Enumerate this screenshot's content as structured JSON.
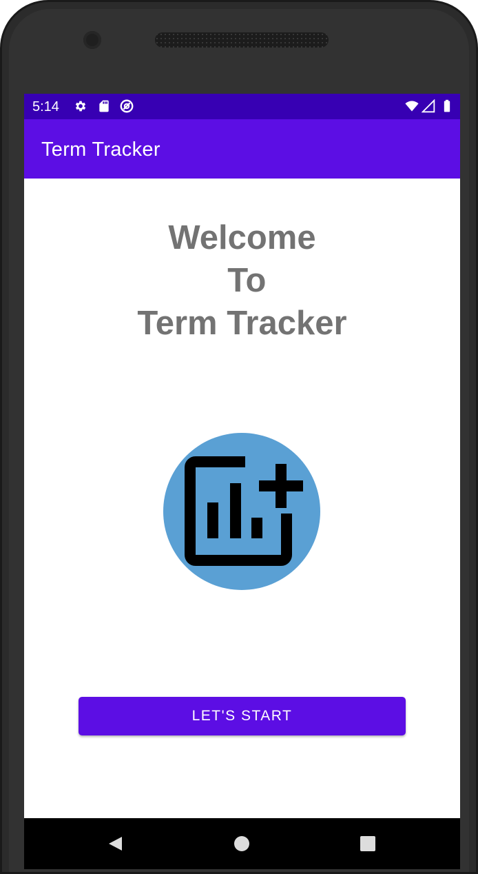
{
  "status_bar": {
    "time": "5:14",
    "icons": [
      "settings-icon",
      "sd-card-icon",
      "sync-icon",
      "wifi-icon",
      "signal-icon",
      "battery-icon"
    ],
    "background": "#3700b3"
  },
  "app_bar": {
    "title": "Term Tracker",
    "background": "#5c0ee4"
  },
  "main": {
    "welcome_lines": [
      "Welcome",
      " To",
      "Term Tracker"
    ],
    "logo_icon": "add-chart-icon",
    "logo_background": "#5aa0d4",
    "start_button_label": "LET'S START",
    "start_button_color": "#5c0ee4"
  },
  "nav_bar": {
    "icons": [
      "back-icon",
      "home-icon",
      "recents-icon"
    ]
  }
}
